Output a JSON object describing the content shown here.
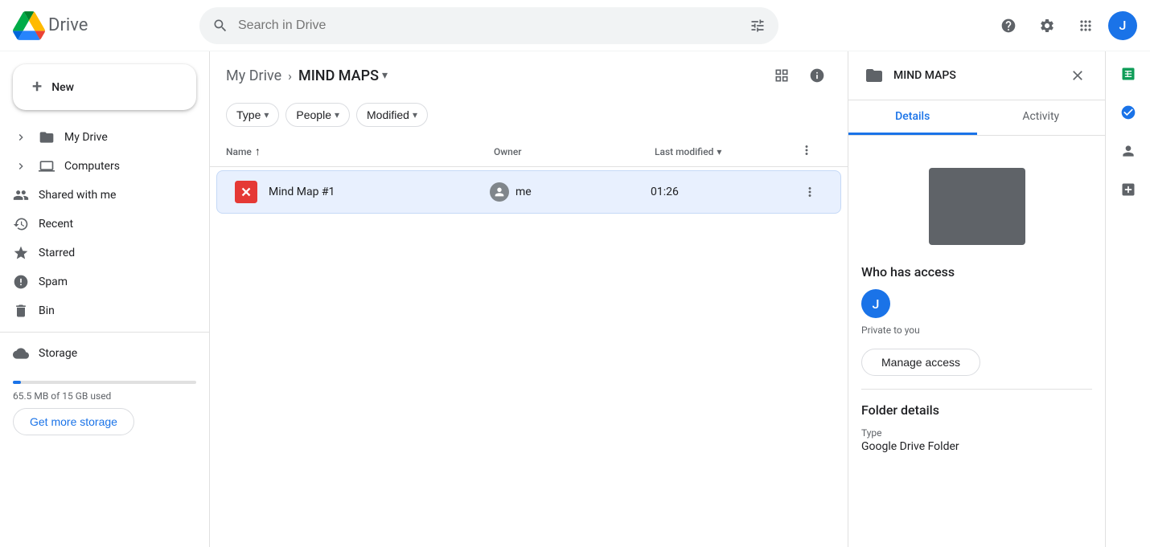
{
  "topbar": {
    "logo_text": "Drive",
    "search_placeholder": "Search in Drive",
    "avatar_letter": "J"
  },
  "sidebar": {
    "new_button_label": "New",
    "items": [
      {
        "id": "my-drive",
        "label": "My Drive",
        "icon": "folder",
        "active": false,
        "has_chevron": true
      },
      {
        "id": "computers",
        "label": "Computers",
        "icon": "computer",
        "active": false,
        "has_chevron": true
      },
      {
        "id": "shared-with-me",
        "label": "Shared with me",
        "icon": "people",
        "active": false
      },
      {
        "id": "recent",
        "label": "Recent",
        "icon": "clock",
        "active": false
      },
      {
        "id": "starred",
        "label": "Starred",
        "icon": "star",
        "active": false
      },
      {
        "id": "spam",
        "label": "Spam",
        "icon": "warning",
        "active": false
      },
      {
        "id": "bin",
        "label": "Bin",
        "icon": "trash",
        "active": false
      },
      {
        "id": "storage",
        "label": "Storage",
        "icon": "cloud",
        "active": false
      }
    ],
    "storage": {
      "used_text": "65.5 MB of 15 GB used",
      "get_more_label": "Get more storage",
      "percent": 4.37
    }
  },
  "breadcrumb": {
    "root": "My Drive",
    "separator": "›",
    "current": "MIND MAPS"
  },
  "filters": [
    {
      "id": "type",
      "label": "Type"
    },
    {
      "id": "people",
      "label": "People"
    },
    {
      "id": "modified",
      "label": "Modified"
    }
  ],
  "list_header": {
    "name_col": "Name",
    "owner_col": "Owner",
    "modified_col": "Last modified",
    "actions_col": ""
  },
  "files": [
    {
      "id": "mind-map-1",
      "name": "Mind Map #1",
      "owner": "me",
      "modified": "01:26",
      "type": "mindmap"
    }
  ],
  "right_panel": {
    "title": "MIND MAPS",
    "tab_details": "Details",
    "tab_activity": "Activity",
    "who_has_access_title": "Who has access",
    "access_avatar_letter": "J",
    "private_text": "Private to you",
    "manage_access_label": "Manage access",
    "folder_details_title": "Folder details",
    "type_label": "Type",
    "type_value": "Google Drive Folder"
  }
}
